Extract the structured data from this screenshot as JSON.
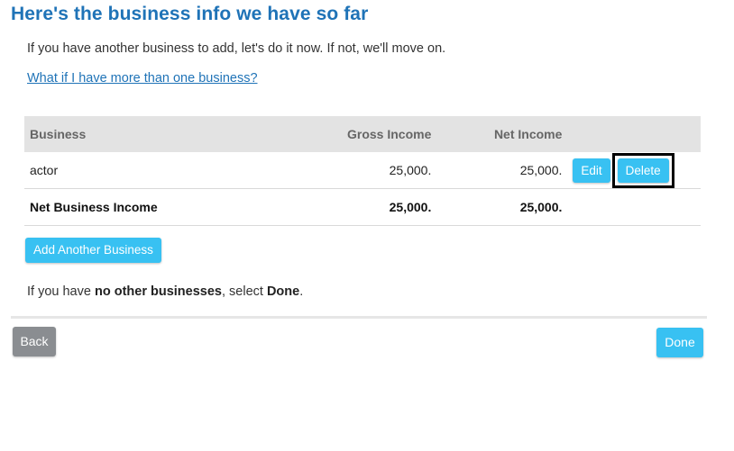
{
  "header": {
    "title": "Here's the business info we have so far"
  },
  "intro": {
    "text": "If you have another business to add, let's do it now. If not, we'll move on.",
    "help_link": "What if I have more than one business?"
  },
  "table": {
    "columns": [
      "Business",
      "Gross Income",
      "Net Income"
    ],
    "rows": [
      {
        "business": "actor",
        "gross_income": "25,000.",
        "net_income": "25,000.",
        "edit_label": "Edit",
        "delete_label": "Delete"
      }
    ],
    "total": {
      "label": "Net Business Income",
      "gross_income": "25,000.",
      "net_income": "25,000."
    }
  },
  "add_button": "Add Another Business",
  "summary": {
    "prefix": "If you have ",
    "emphasis1": "no other businesses",
    "middle": ", select ",
    "emphasis2": "Done",
    "suffix": "."
  },
  "footer": {
    "back_label": "Back",
    "done_label": "Done"
  },
  "colors": {
    "title_blue": "#1f73b7",
    "button_blue": "#38c1f2",
    "button_gray": "#8a8d91",
    "header_gray": "#e3e3e3"
  }
}
